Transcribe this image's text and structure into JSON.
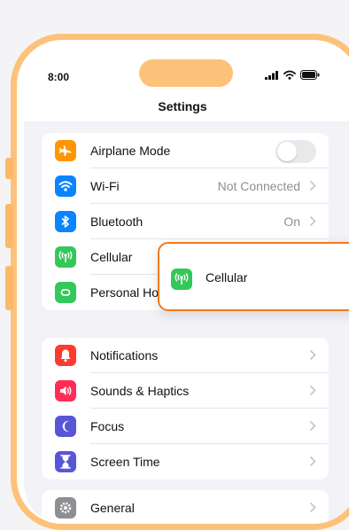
{
  "status_bar": {
    "time": "8:00"
  },
  "nav": {
    "title": "Settings"
  },
  "group1": [
    {
      "label": "Airplane Mode",
      "icon": "airplane-icon",
      "color": "#ff9500",
      "control": "toggle",
      "toggle_on": false
    },
    {
      "label": "Wi-Fi",
      "icon": "wifi-icon",
      "color": "#0a84ff",
      "value": "Not Connected"
    },
    {
      "label": "Bluetooth",
      "icon": "bluetooth-icon",
      "color": "#0a84ff",
      "value": "On"
    },
    {
      "label": "Cellular",
      "icon": "cellular-antenna-icon",
      "color": "#34c759"
    },
    {
      "label": "Personal Ho",
      "icon": "personal-hotspot-icon",
      "color": "#34c759"
    }
  ],
  "group2": [
    {
      "label": "Notifications",
      "icon": "bell-icon",
      "color": "#ff3b30"
    },
    {
      "label": "Sounds & Haptics",
      "icon": "speaker-icon",
      "color": "#ff2d55"
    },
    {
      "label": "Focus",
      "icon": "moon-icon",
      "color": "#5856d6"
    },
    {
      "label": "Screen Time",
      "icon": "hourglass-icon",
      "color": "#5856d6"
    }
  ],
  "group3": [
    {
      "label": "General",
      "icon": "gear-icon",
      "color": "#8e8e93"
    }
  ],
  "callout": {
    "label": "Cellular",
    "icon": "cellular-antenna-icon",
    "color": "#34c759"
  }
}
